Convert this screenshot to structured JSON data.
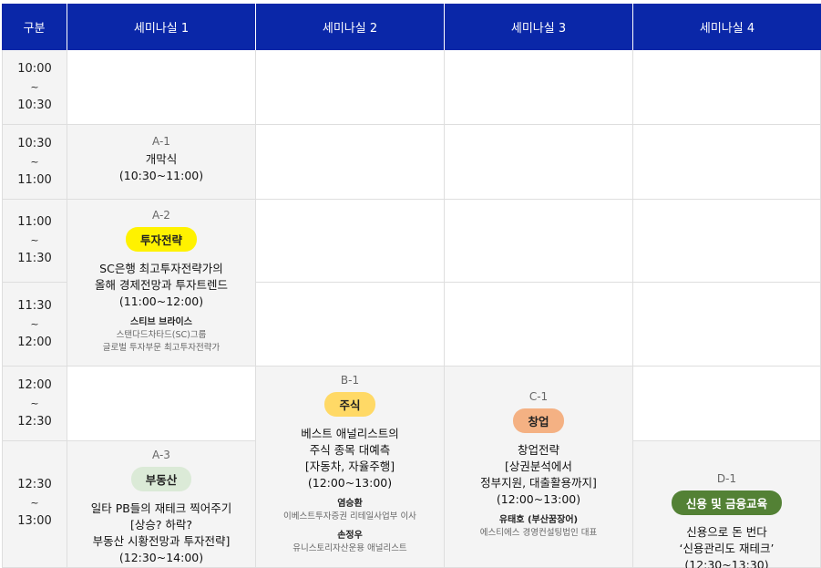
{
  "header": {
    "col0": "구분",
    "rooms": [
      "세미나실 1",
      "세미나실 2",
      "세미나실 3",
      "세미나실 4"
    ]
  },
  "times": [
    {
      "start": "10:00",
      "sep": "~",
      "end": "10:30"
    },
    {
      "start": "10:30",
      "sep": "~",
      "end": "11:00"
    },
    {
      "start": "11:00",
      "sep": "~",
      "end": "11:30"
    },
    {
      "start": "11:30",
      "sep": "~",
      "end": "12:00"
    },
    {
      "start": "12:00",
      "sep": "~",
      "end": "12:30"
    },
    {
      "start": "12:30",
      "sep": "~",
      "end": "13:00"
    }
  ],
  "sessions": {
    "a1": {
      "code": "A-1",
      "title1": "개막식",
      "time": "(10:30~11:00)"
    },
    "a2": {
      "code": "A-2",
      "badge": "투자전략",
      "title1": "SC은행 최고투자전략가의",
      "title2": "올해 경제전망과 투자트렌드",
      "time": "(11:00~12:00)",
      "speaker": "스티브 브라이스",
      "aff1": "스탠다드차타드(SC)그룹",
      "aff2": "글로벌 투자부문 최고투자전략가"
    },
    "a3": {
      "code": "A-3",
      "badge": "부동산",
      "title1": "일타 PB들의 재테크 찍어주기",
      "title2": "[상승? 하락?",
      "title3": "부동산 시황전망과 투자전략]",
      "time": "(12:30~14:00)"
    },
    "b1": {
      "code": "B-1",
      "badge": "주식",
      "title1": "베스트 애널리스트의",
      "title2": "주식 종목 대예측",
      "title3": "[자동차, 자율주행]",
      "time": "(12:00~13:00)",
      "speaker1": "염승환",
      "aff1": "이베스트투자증권 리테일사업부 이사",
      "speaker2": "손정우",
      "aff2": "유니스토리자산운용 애널리스트"
    },
    "c1": {
      "code": "C-1",
      "badge": "창업",
      "title1": "창업전략",
      "title2": "[상권분석에서",
      "title3": "정부지원, 대출활용까지]",
      "time": "(12:00~13:00)",
      "speaker": "유태호 (부산꿈장어)",
      "aff": "에스티에스 경영컨설팅법인 대표"
    },
    "d1": {
      "code": "D-1",
      "badge": "신용 및 금융교육",
      "title1": "신용으로 돈 번다",
      "title2": "‘신용관리도 재테크’",
      "time": "(12:30~13:30)"
    }
  },
  "colors": {
    "header_bg": "#0a27a8",
    "badge_investment": "#fff200",
    "badge_realestate": "#dbead7",
    "badge_stock": "#ffd966",
    "badge_startup": "#f4b183",
    "badge_credit": "#538135"
  }
}
